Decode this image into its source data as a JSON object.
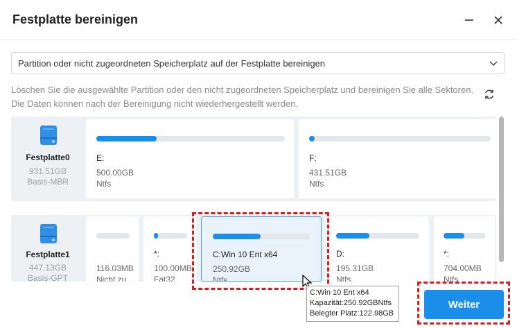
{
  "window": {
    "title": "Festplatte bereinigen"
  },
  "dropdown": {
    "selected": "Partition oder nicht zugeordneten Speicherplatz auf der Festplatte bereinigen"
  },
  "description": "Löschen Sie die ausgewählte Partition oder den nicht zugeordneten Speicherplatz und bereinigen Sie alle Sektoren. Die Daten können nach der Bereinigung nicht wiederhergestellt werden.",
  "disks": [
    {
      "name": "Festplatte0",
      "size": "931.51GB",
      "type": "Basis-MBR",
      "partitions": [
        {
          "label": "E:",
          "size": "500.00GB",
          "fs": "Ntfs",
          "used": 0.32
        },
        {
          "label": "F:",
          "size": "431.51GB",
          "fs": "Ntfs",
          "used": 0.02
        }
      ]
    },
    {
      "name": "Festplatte1",
      "size": "447.13GB",
      "type": "Basis-GPT",
      "partitions": [
        {
          "label": "",
          "size": "116.03MB",
          "fs": "Nicht zu…",
          "used": 0
        },
        {
          "label": "*:",
          "size": "100.00MB",
          "fs": "Fat32",
          "used": 0.12
        },
        {
          "label": "C:Win 10 Ent x64",
          "size": "250.92GB",
          "fs": "Ntfs",
          "used": 0.49
        },
        {
          "label": "D:",
          "size": "195.31GB",
          "fs": "Ntfs",
          "used": 0.4
        },
        {
          "label": "*:",
          "size": "704.00MB",
          "fs": "Ntfs",
          "used": 0.5
        }
      ]
    }
  ],
  "tooltip": {
    "line1": "C:Win 10 Ent x64",
    "line2": "Kapazität:250.92GBNtfs",
    "line3": "Belegter Platz:122.98GB"
  },
  "buttons": {
    "next": "Weiter"
  },
  "colors": {
    "accent": "#1a8ee8",
    "highlight": "#e0191d"
  }
}
